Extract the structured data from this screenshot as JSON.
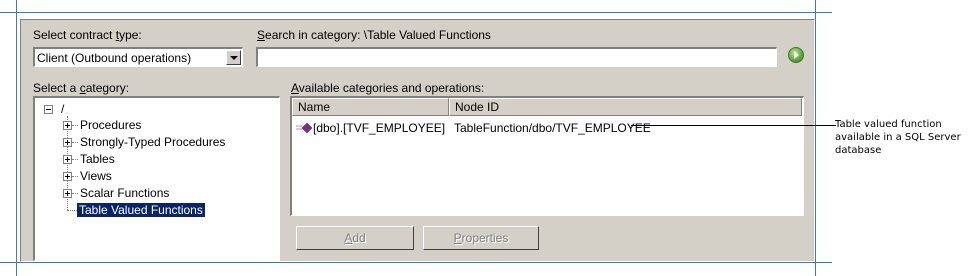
{
  "contract_type": {
    "label_prefix": "Select contract ",
    "label_accel": "t",
    "label_suffix": "ype:",
    "value": "Client (Outbound operations)"
  },
  "search": {
    "label_accel": "S",
    "label_rest": "earch in category: \\Table Valued Functions",
    "value": ""
  },
  "category": {
    "label_prefix": "Select a ",
    "label_accel": "c",
    "label_suffix": "ategory:",
    "root": "/",
    "items": [
      {
        "label": "Procedures"
      },
      {
        "label": "Strongly-Typed Procedures"
      },
      {
        "label": "Tables"
      },
      {
        "label": "Views"
      },
      {
        "label": "Scalar Functions"
      },
      {
        "label": "Table Valued Functions"
      }
    ]
  },
  "operations": {
    "label_accel": "A",
    "label_rest": "vailable categories and operations:",
    "columns": [
      "Name",
      "Node ID"
    ],
    "rows": [
      {
        "name": "[dbo].[TVF_EMPLOYEE]",
        "node_id": "TableFunction/dbo/TVF_EMPLOYEE"
      }
    ]
  },
  "buttons": {
    "add": {
      "accel": "A",
      "rest": "dd"
    },
    "properties": {
      "accel": "P",
      "rest": "roperties"
    }
  },
  "callout": {
    "lines": [
      "Table valued function",
      "available in a SQL Server",
      "database"
    ]
  },
  "colors": {
    "dialog_bg": "#d4d0c8",
    "selection": "#0a246a",
    "guide_lines": "#3a78c8"
  }
}
